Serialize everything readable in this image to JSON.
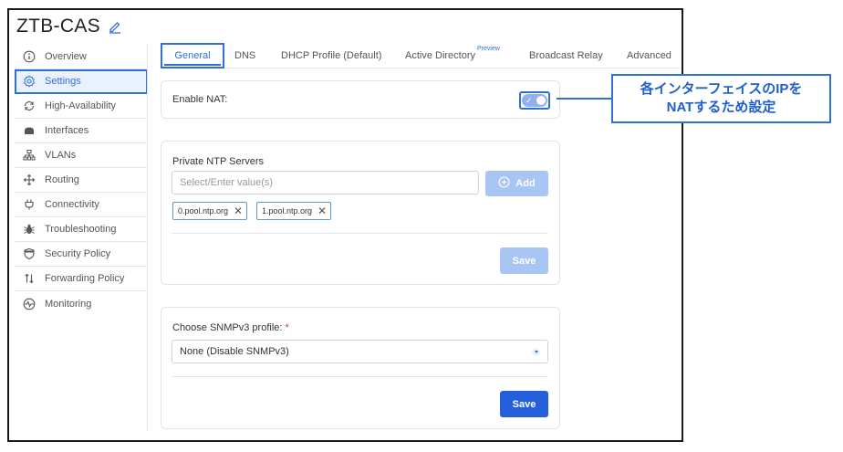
{
  "header": {
    "title": "ZTB-CAS",
    "edit_icon": "pencil-icon"
  },
  "sidebar": {
    "items": [
      {
        "label": "Overview",
        "icon": "info-icon"
      },
      {
        "label": "Settings",
        "icon": "gear-icon",
        "active": true
      },
      {
        "label": "High-Availability",
        "icon": "sync-icon"
      },
      {
        "label": "Interfaces",
        "icon": "interface-icon"
      },
      {
        "label": "VLANs",
        "icon": "network-icon"
      },
      {
        "label": "Routing",
        "icon": "move-arrows-icon"
      },
      {
        "label": "Connectivity",
        "icon": "plug-icon"
      },
      {
        "label": "Troubleshooting",
        "icon": "bug-icon"
      },
      {
        "label": "Security Policy",
        "icon": "shield-icon"
      },
      {
        "label": "Forwarding Policy",
        "icon": "swap-arrows-icon"
      },
      {
        "label": "Monitoring",
        "icon": "heartbeat-icon"
      }
    ]
  },
  "tabs": [
    {
      "label": "General",
      "active": true
    },
    {
      "label": "DNS"
    },
    {
      "label": "DHCP Profile (Default)"
    },
    {
      "label": "Active Directory",
      "badge": "Preview"
    },
    {
      "label": "Broadcast Relay"
    },
    {
      "label": "Advanced"
    }
  ],
  "nat": {
    "label": "Enable NAT:",
    "enabled": true
  },
  "ntp": {
    "label": "Private NTP Servers",
    "placeholder": "Select/Enter value(s)",
    "add_label": "Add",
    "servers": [
      "0.pool.ntp.org",
      "1.pool.ntp.org"
    ],
    "save_label": "Save"
  },
  "snmp": {
    "label": "Choose SNMPv3 profile:",
    "required_mark": "*",
    "selected": "None (Disable SNMPv3)",
    "save_label": "Save"
  },
  "callout": {
    "line1": "各インターフェイスのIPを",
    "line2": "NATするため設定"
  },
  "colors": {
    "accent": "#2f6fd6",
    "primary_button": "#2360d9",
    "disabled_button": "#a9c5f3",
    "toggle_track": "#8fb1ee"
  }
}
